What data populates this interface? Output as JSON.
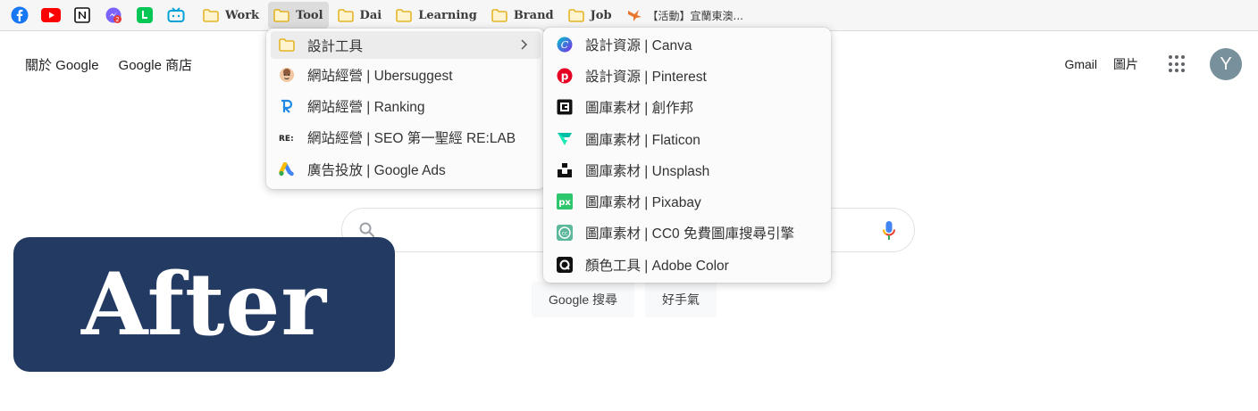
{
  "bookmarks": {
    "icons": [
      "facebook-icon",
      "youtube-icon",
      "notion-icon",
      "messenger-icon",
      "line-icon",
      "bilibili-icon"
    ],
    "folders": [
      {
        "label": "Work"
      },
      {
        "label": "Tool",
        "active": true
      },
      {
        "label": "Dai"
      },
      {
        "label": "Learning"
      },
      {
        "label": "Brand"
      },
      {
        "label": "Job"
      }
    ],
    "event_label": "【活動】宜蘭東澳..."
  },
  "header": {
    "about": "關於 Google",
    "store": "Google 商店",
    "gmail": "Gmail",
    "images": "圖片",
    "avatar_letter": "Y"
  },
  "search": {
    "btn_search": "Google 搜尋",
    "btn_lucky": "好手氣"
  },
  "menu_main": [
    {
      "icon": "folder-icon",
      "label": "設計工具",
      "submenu": true
    },
    {
      "icon": "ubersuggest-icon",
      "label": "網站經營 | Ubersuggest"
    },
    {
      "icon": "ranking-icon",
      "label": "網站經營 | Ranking"
    },
    {
      "icon": "relab-icon",
      "label": "網站經營 | SEO 第一聖經 RE:LAB"
    },
    {
      "icon": "google-ads-icon",
      "label": "廣告投放 | Google Ads"
    }
  ],
  "menu_sub": [
    {
      "icon": "canva-icon",
      "label": "設計資源 | Canva"
    },
    {
      "icon": "pinterest-icon",
      "label": "設計資源 | Pinterest"
    },
    {
      "icon": "chuangzuobang-icon",
      "label": "圖庫素材 | 創作邦"
    },
    {
      "icon": "flaticon-icon",
      "label": "圖庫素材 | Flaticon"
    },
    {
      "icon": "unsplash-icon",
      "label": "圖庫素材 | Unsplash"
    },
    {
      "icon": "pixabay-icon",
      "label": "圖庫素材 | Pixabay"
    },
    {
      "icon": "cc0-icon",
      "label": "圖庫素材 | CC0 免費圖庫搜尋引擎"
    },
    {
      "icon": "adobe-color-icon",
      "label": "顏色工具 | Adobe Color"
    }
  ],
  "badge": {
    "text": "After"
  },
  "colors": {
    "badge_bg": "#233a63",
    "folder": "#f6c244",
    "avatar": "#78909c"
  }
}
